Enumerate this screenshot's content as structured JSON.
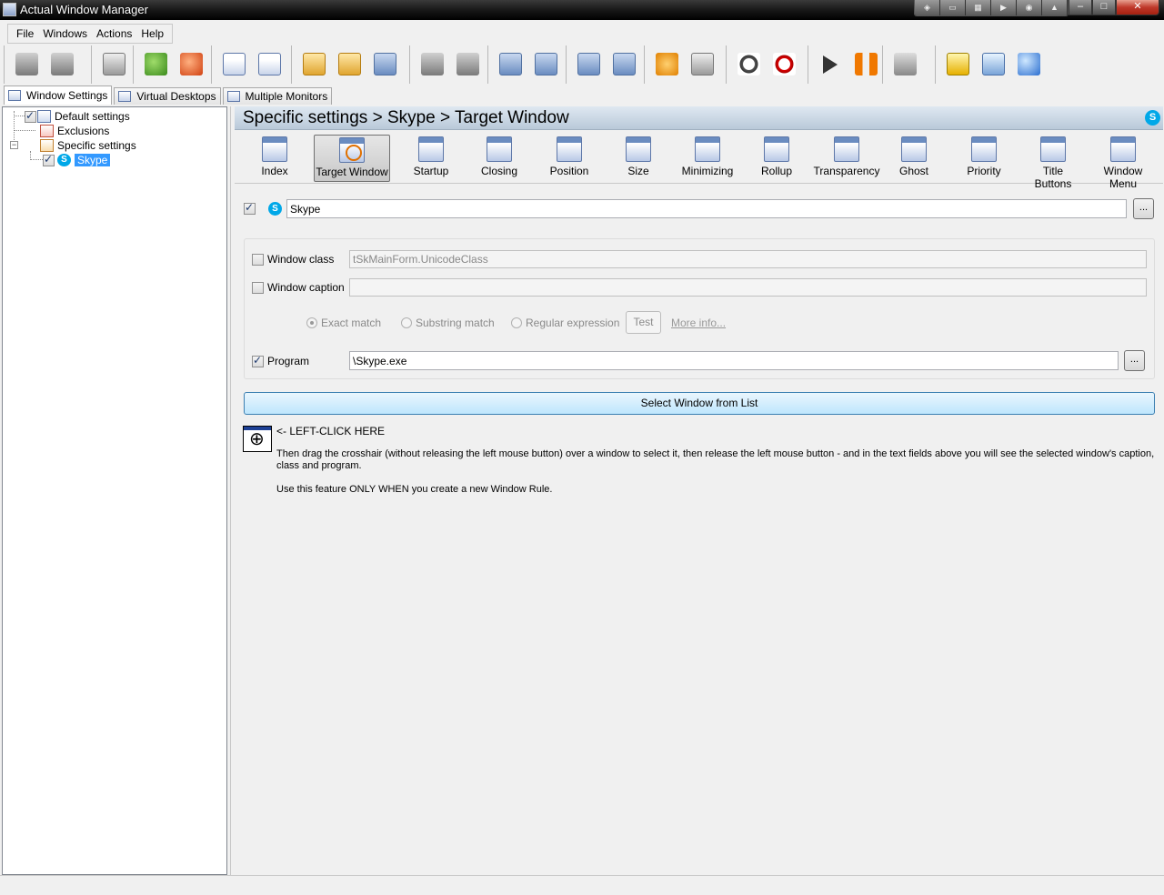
{
  "window": {
    "title": "Actual Window Manager"
  },
  "menu": [
    "File",
    "Windows",
    "Actions",
    "Help"
  ],
  "title_extra_buttons": [
    "rollup-icon",
    "minimize-to-tray-icon",
    "transparency-icon",
    "stay-on-top-icon",
    "ghost-icon",
    "pin-icon"
  ],
  "left_tabs": [
    {
      "label": "Window Settings"
    },
    {
      "label": "Virtual Desktops"
    },
    {
      "label": "Multiple Monitors"
    }
  ],
  "tree": {
    "default": "Default settings",
    "exclusions": "Exclusions",
    "specific": "Specific settings",
    "skype": "Skype"
  },
  "header": {
    "title": "Specific settings > Skype > Target Window"
  },
  "categories": [
    {
      "label": "Index"
    },
    {
      "label": "Target Window"
    },
    {
      "label": "Startup"
    },
    {
      "label": "Closing"
    },
    {
      "label": "Position"
    },
    {
      "label": "Size"
    },
    {
      "label": "Minimizing"
    },
    {
      "label": "Rollup"
    },
    {
      "label": "Transparency"
    },
    {
      "label": "Ghost"
    },
    {
      "label": "Priority"
    },
    {
      "label": "Title Buttons"
    },
    {
      "label": "Window Menu"
    }
  ],
  "rule": {
    "name": "Skype",
    "enabled": true,
    "browse_label": "..."
  },
  "criteria": {
    "window_class": {
      "label": "Window class",
      "value": "tSkMainForm.UnicodeClass",
      "checked": false
    },
    "window_caption": {
      "label": "Window caption",
      "value": "",
      "checked": false
    },
    "match_options": [
      "Exact match",
      "Substring match",
      "Regular expression"
    ],
    "test_label": "Test",
    "more_info": "More info...",
    "program": {
      "label": "Program",
      "value": "\\Skype.exe",
      "checked": true
    },
    "program_browse": "..."
  },
  "select_button": "Select Window from List",
  "finder": {
    "left_click": "<- LEFT-CLICK HERE",
    "instructions": "Then drag the crosshair (without releasing the left mouse button) over a window to select it, then release the left mouse button - and in the text fields above you will see the selected window's caption, class and program.",
    "note": "Use this feature ONLY WHEN you create a new Window Rule."
  },
  "colors": {
    "selection": "#3399ff",
    "header_bg": "#c9d7e5",
    "skype_blue": "#00a8e8",
    "button_blue": "#bee6fd"
  }
}
